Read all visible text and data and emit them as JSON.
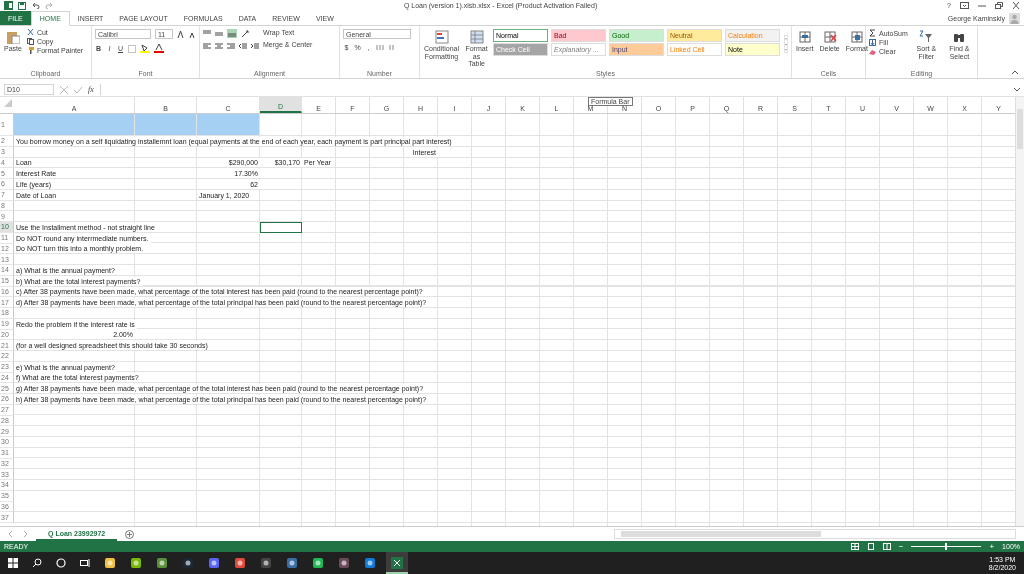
{
  "title_bar": {
    "title": "Q Loan (version 1).xlsb.xlsx - Excel (Product Activation Failed)",
    "help": "?"
  },
  "tabs": [
    {
      "label": "FILE",
      "kind": "file",
      "selected": false
    },
    {
      "label": "HOME",
      "kind": "tab",
      "selected": true
    },
    {
      "label": "INSERT",
      "kind": "tab",
      "selected": false
    },
    {
      "label": "PAGE LAYOUT",
      "kind": "tab",
      "selected": false
    },
    {
      "label": "FORMULAS",
      "kind": "tab",
      "selected": false
    },
    {
      "label": "DATA",
      "kind": "tab",
      "selected": false
    },
    {
      "label": "REVIEW",
      "kind": "tab",
      "selected": false
    },
    {
      "label": "VIEW",
      "kind": "tab",
      "selected": false
    }
  ],
  "user": {
    "name": "George Kaminskiy"
  },
  "ribbon": {
    "clipboard": {
      "label": "Clipboard",
      "paste": "Paste",
      "cut": "Cut",
      "copy": "Copy",
      "format_painter": "Format Painter"
    },
    "font": {
      "label": "Font",
      "name": "Calibri",
      "size": "11",
      "bold": "B",
      "italic": "I",
      "underline": "U"
    },
    "alignment": {
      "label": "Alignment",
      "wrap": "Wrap Text",
      "merge": "Merge & Center"
    },
    "number": {
      "label": "Number",
      "format": "General",
      "currency": "$",
      "percent": "%",
      "comma": ","
    },
    "styles": {
      "label": "Styles",
      "conditional": "Conditional Formatting",
      "format_table": "Format as Table",
      "cells": [
        {
          "label": "Normal",
          "color": "#ffffff",
          "selected": true
        },
        {
          "label": "Bad",
          "color": "#ffc7ce",
          "selected": false
        },
        {
          "label": "Good",
          "color": "#c6efce",
          "selected": false
        },
        {
          "label": "Neutral",
          "color": "#ffeb9c",
          "selected": false
        },
        {
          "label": "Calculation",
          "color": "#f2f2f2",
          "selected": false
        },
        {
          "label": "Check Cell",
          "color": "#a5a5a5",
          "selected": false
        },
        {
          "label": "Explanatory ...",
          "color": "#ffffff",
          "selected": false
        },
        {
          "label": "Input",
          "color": "#ffcc99",
          "selected": false
        },
        {
          "label": "Linked Cell",
          "color": "#ffffff",
          "selected": false
        },
        {
          "label": "Note",
          "color": "#ffffcc",
          "selected": false
        }
      ]
    },
    "cells": {
      "label": "Cells",
      "buttons": [
        "Insert",
        "Delete",
        "Format"
      ]
    },
    "editing": {
      "label": "Editing",
      "autosum": "AutoSum",
      "fill": "Fill",
      "clear": "Clear",
      "sort": "Sort & Filter",
      "find": "Find & Select"
    }
  },
  "formula_bar": {
    "name_box": "D10",
    "fx": "fx",
    "tooltip": "Formula Bar"
  },
  "columns": [
    {
      "label": "A",
      "selected": false
    },
    {
      "label": "B",
      "selected": false
    },
    {
      "label": "C",
      "selected": false
    },
    {
      "label": "D",
      "selected": true
    },
    {
      "label": "E",
      "selected": false
    },
    {
      "label": "F",
      "selected": false
    },
    {
      "label": "G",
      "selected": false
    },
    {
      "label": "H",
      "selected": false
    },
    {
      "label": "I",
      "selected": false
    },
    {
      "label": "J",
      "selected": false
    },
    {
      "label": "K",
      "selected": false
    },
    {
      "label": "L",
      "selected": false
    },
    {
      "label": "M",
      "selected": false
    },
    {
      "label": "N",
      "selected": false
    },
    {
      "label": "O",
      "selected": false
    },
    {
      "label": "P",
      "selected": false
    },
    {
      "label": "Q",
      "selected": false
    },
    {
      "label": "R",
      "selected": false
    },
    {
      "label": "S",
      "selected": false
    },
    {
      "label": "T",
      "selected": false
    },
    {
      "label": "U",
      "selected": false
    },
    {
      "label": "V",
      "selected": false
    },
    {
      "label": "W",
      "selected": false
    },
    {
      "label": "X",
      "selected": false
    },
    {
      "label": "Y",
      "selected": false
    }
  ],
  "rows": [
    {
      "number": "1",
      "selected": false,
      "cells": {
        "A": {
          "color": "#a6cff4"
        },
        "B": {
          "color": "#a6cff4"
        },
        "C": {
          "color": "#a6cff4"
        }
      }
    },
    {
      "number": "2",
      "selected": false,
      "cells": {
        "A": {
          "text": "You borrow money on a self liquidating installemnt loan (equal payments at the end of each year, each payment is part principal part interest)"
        }
      }
    },
    {
      "number": "3",
      "selected": false,
      "cells": {
        "H": {
          "text": "Interest",
          "align_right": true
        }
      }
    },
    {
      "number": "4",
      "selected": false,
      "cells": {
        "A": {
          "text": "Loan"
        },
        "C": {
          "text": "$290,000",
          "align_right": true
        },
        "D": {
          "text": "$30,170",
          "align_right": true
        },
        "E": {
          "text": "Per Year"
        }
      }
    },
    {
      "number": "5",
      "selected": false,
      "cells": {
        "A": {
          "text": "Interest Rate"
        },
        "C": {
          "text": "17.30%",
          "align_right": true
        }
      }
    },
    {
      "number": "6",
      "selected": false,
      "cells": {
        "A": {
          "text": "Life (years)"
        },
        "C": {
          "text": "62",
          "align_right": true
        }
      }
    },
    {
      "number": "7",
      "selected": false,
      "cells": {
        "A": {
          "text": "Date of Loan"
        },
        "C": {
          "text": "January 1, 2020"
        }
      }
    },
    {
      "number": "8",
      "selected": false
    },
    {
      "number": "9",
      "selected": false
    },
    {
      "number": "10",
      "selected": true,
      "cells": {
        "A": {
          "text": "Use the Installment method - not straight line"
        },
        "D": {
          "selected": true
        }
      }
    },
    {
      "number": "11",
      "selected": false,
      "cells": {
        "A": {
          "text": "Do NOT round any interrmediate numbers."
        }
      }
    },
    {
      "number": "12",
      "selected": false,
      "cells": {
        "A": {
          "text": "Do NOT turn this into a monthly problem."
        }
      }
    },
    {
      "number": "13",
      "selected": false
    },
    {
      "number": "14",
      "selected": false,
      "cells": {
        "A": {
          "text": "a) What is the annual payment?"
        }
      }
    },
    {
      "number": "15",
      "selected": false,
      "cells": {
        "A": {
          "text": "b) What are the total interest payments?"
        }
      }
    },
    {
      "number": "16",
      "selected": false,
      "cells": {
        "A": {
          "text": "c) After 38 payments have been made, what percentage of the total interest has been paid (round to the nearest percentage point)?"
        }
      }
    },
    {
      "number": "17",
      "selected": false,
      "cells": {
        "A": {
          "text": "d) After 38 payments have been made, what percentage of the total principal has been paid (round to the nearest percentage point)?"
        }
      }
    },
    {
      "number": "18",
      "selected": false
    },
    {
      "number": "19",
      "selected": false,
      "cells": {
        "A": {
          "text": "Redo the problem if the interest rate is"
        }
      }
    },
    {
      "number": "20",
      "selected": false,
      "cells": {
        "A": {
          "text": "2.00%",
          "align_right": true
        }
      }
    },
    {
      "number": "21",
      "selected": false,
      "cells": {
        "A": {
          "text": "(for a well designed spreadsheet this should take 30 seconds)"
        }
      }
    },
    {
      "number": "22",
      "selected": false
    },
    {
      "number": "23",
      "selected": false,
      "cells": {
        "A": {
          "text": "e) What is the annual payment?"
        }
      }
    },
    {
      "number": "24",
      "selected": false,
      "cells": {
        "A": {
          "text": "f) What are the total interest payments?"
        }
      }
    },
    {
      "number": "25",
      "selected": false,
      "cells": {
        "A": {
          "text": "g) After 38 payments have been made, what percentage of the total interest has been paid (round to the nearest percentage point)?"
        }
      }
    },
    {
      "number": "26",
      "selected": false,
      "cells": {
        "A": {
          "text": "h) After 38 payments have been made, what percentage of the total principal has been paid (round to the nearest percentage point)?"
        }
      }
    },
    {
      "number": "27",
      "selected": false
    },
    {
      "number": "28",
      "selected": false
    },
    {
      "number": "29",
      "selected": false
    },
    {
      "number": "30",
      "selected": false
    },
    {
      "number": "31",
      "selected": false
    },
    {
      "number": "32",
      "selected": false
    },
    {
      "number": "33",
      "selected": false
    },
    {
      "number": "34",
      "selected": false
    },
    {
      "number": "35",
      "selected": false
    },
    {
      "number": "36",
      "selected": false
    },
    {
      "number": "37",
      "selected": false
    }
  ],
  "sheet_tabs": [
    {
      "label": "Q Loan 23992972",
      "selected": true
    }
  ],
  "status_bar": {
    "status": "READY",
    "zoom_out": "−",
    "zoom_in": "+",
    "zoom": "100%",
    "level": 0.5
  },
  "taskbar": {
    "time": "1:53 PM",
    "date": "8/2/2020"
  }
}
